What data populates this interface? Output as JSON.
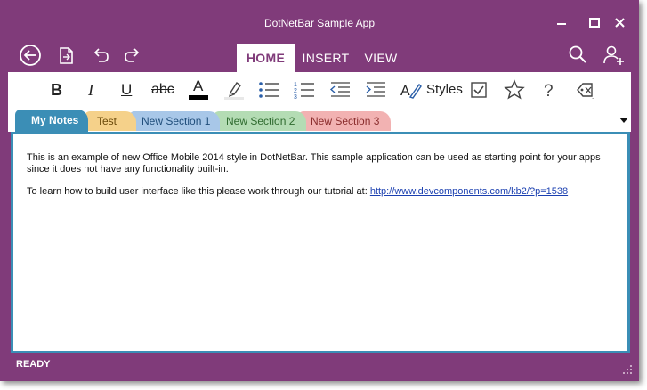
{
  "window": {
    "title": "DotNetBar Sample App",
    "accent_color": "#803b7a"
  },
  "quick_access": [
    {
      "icon": "back-arrow-icon"
    },
    {
      "icon": "new-document-icon"
    },
    {
      "icon": "undo-icon"
    },
    {
      "icon": "redo-icon"
    }
  ],
  "ribbon_tabs": [
    {
      "label": "HOME",
      "active": true
    },
    {
      "label": "INSERT",
      "active": false
    },
    {
      "label": "VIEW",
      "active": false
    }
  ],
  "ribbon_right": [
    {
      "icon": "search-icon"
    },
    {
      "icon": "add-user-icon"
    }
  ],
  "toolbar": {
    "bold_label": "B",
    "italic_label": "I",
    "underline_label": "U",
    "strikethrough_label": "abc",
    "font_color_label": "A",
    "styles_label": "Styles",
    "icons": [
      "font-color-icon",
      "highlight-icon",
      "bullet-list-icon",
      "numbered-list-icon",
      "decrease-indent-icon",
      "increase-indent-icon",
      "styles-icon",
      "checkbox-icon",
      "star-icon",
      "question-icon",
      "clear-formatting-icon"
    ]
  },
  "section_tabs": [
    {
      "label": "My Notes",
      "color": "#3b8eb6",
      "active": true
    },
    {
      "label": "Test",
      "color": "#f5d18a",
      "active": false
    },
    {
      "label": "New Section 1",
      "color": "#a8c7e8",
      "active": false
    },
    {
      "label": "New Section 2",
      "color": "#b4dcb4",
      "active": false
    },
    {
      "label": "New Section 3",
      "color": "#f2b2b2",
      "active": false
    }
  ],
  "content": {
    "paragraph1": "This is an example of new Office Mobile 2014 style in DotNetBar. This sample application can be used as starting point for your apps since it does not have any functionality built-in.",
    "paragraph2_prefix": "To learn how to build user interface like this please work through our tutorial at: ",
    "link_text": "http://www.devcomponents.com/kb2/?p=1538"
  },
  "status": {
    "text": "READY"
  }
}
